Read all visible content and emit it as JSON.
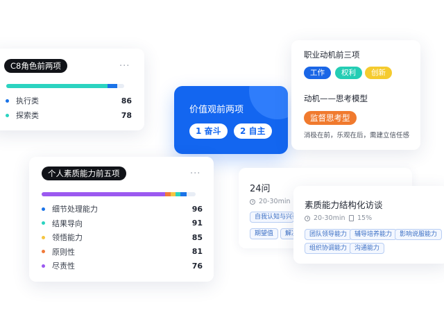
{
  "colors": {
    "primary": "#1366f0",
    "exec": "#1a73e8",
    "explore": "#2bd3c0",
    "purple": "#9b59f0",
    "orange": "#f07a3a",
    "yellow": "#f5c542"
  },
  "c8_card": {
    "title": "C8角色前两项",
    "menu": "···",
    "bar": [
      {
        "share": 0.86,
        "color": "#2bd3c0"
      },
      {
        "share": 0.08,
        "color": "#1a73e8"
      }
    ],
    "items": [
      {
        "label": "执行类",
        "value": "86",
        "color": "#1a73e8"
      },
      {
        "label": "探索类",
        "value": "78",
        "color": "#2bd3c0"
      }
    ]
  },
  "value_card": {
    "title": "价值观前两项",
    "chips": [
      "1 奋斗",
      "2 自主"
    ]
  },
  "motivation_card": {
    "title": "职业动机前三项",
    "tags": [
      {
        "label": "工作",
        "bg": "#1a66e6",
        "fg": "#ffffff"
      },
      {
        "label": "权利",
        "bg": "#24cdb4",
        "fg": "#ffffff"
      },
      {
        "label": "创新",
        "bg": "#f5cb2e",
        "fg": "#ffffff"
      }
    ],
    "model_title": "动机——思考模型",
    "model_tag": "监督思考型",
    "model_desc": "消极在前，乐观在后，需建立信任感"
  },
  "ability_card": {
    "title": "个人素质能力前五项",
    "menu": "···",
    "bar": [
      {
        "share": 0.8,
        "color": "#9b59f0"
      },
      {
        "share": 0.04,
        "color": "#f07a3a"
      },
      {
        "share": 0.03,
        "color": "#f5c542"
      },
      {
        "share": 0.03,
        "color": "#2bd3c0"
      },
      {
        "share": 0.04,
        "color": "#1a73e8"
      }
    ],
    "items": [
      {
        "label": "细节处理能力",
        "value": "96",
        "color": "#1a73e8"
      },
      {
        "label": "结果导向",
        "value": "91",
        "color": "#2bd3c0"
      },
      {
        "label": "领悟能力",
        "value": "85",
        "color": "#f5c542"
      },
      {
        "label": "原则性",
        "value": "81",
        "color": "#f07a3a"
      },
      {
        "label": "尽责性",
        "value": "76",
        "color": "#9b59f0"
      }
    ]
  },
  "question_card": {
    "title": "24问",
    "duration": "20-30min",
    "chips": [
      "自我认知与兴奋",
      "期望值",
      "解决"
    ]
  },
  "interview_card": {
    "title": "素质能力结构化访谈",
    "duration": "20-30min",
    "ratio": "15%",
    "chips": [
      "团队领导能力",
      "辅导培养能力",
      "影响说服能力",
      "组织协调能力",
      "沟通能力"
    ]
  }
}
